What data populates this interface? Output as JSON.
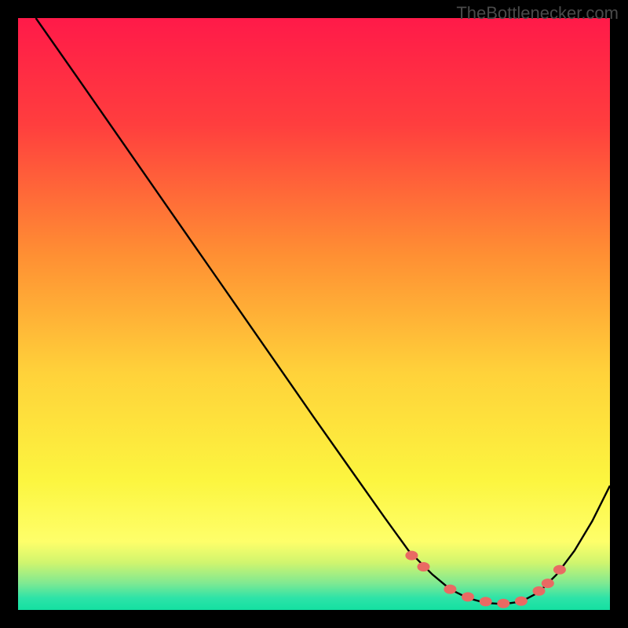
{
  "watermark": "TheBottlenecker.com",
  "chart_data": {
    "type": "line",
    "title": "",
    "xlabel": "",
    "ylabel": "",
    "xlim": [
      0,
      100
    ],
    "ylim": [
      0,
      100
    ],
    "background": "heat-gradient",
    "series": [
      {
        "name": "curve",
        "x": [
          3,
          10,
          18,
          26,
          34,
          42,
          50,
          56,
          62,
          66,
          70,
          73,
          76,
          79,
          82,
          85,
          88,
          91,
          94,
          97,
          100
        ],
        "y": [
          100,
          90,
          78.5,
          67,
          55.5,
          44,
          32.5,
          24,
          15.5,
          10,
          6,
          3.5,
          2,
          1.2,
          1,
          1.4,
          3,
          6,
          10,
          15,
          21
        ]
      }
    ],
    "markers": {
      "name": "dots",
      "color": "#e96a63",
      "x": [
        66.5,
        68.5,
        73,
        76,
        79,
        82,
        85,
        88,
        89.5,
        91.5
      ],
      "y": [
        9.2,
        7.3,
        3.5,
        2.2,
        1.4,
        1.1,
        1.5,
        3.2,
        4.5,
        6.8
      ]
    }
  },
  "gradient_stops": [
    {
      "offset": 0,
      "color": "#ff1a49"
    },
    {
      "offset": 0.18,
      "color": "#ff3e3e"
    },
    {
      "offset": 0.4,
      "color": "#ff8f33"
    },
    {
      "offset": 0.6,
      "color": "#ffd23a"
    },
    {
      "offset": 0.78,
      "color": "#fcf53f"
    },
    {
      "offset": 0.885,
      "color": "#feff6a"
    },
    {
      "offset": 0.92,
      "color": "#d0f56e"
    },
    {
      "offset": 0.955,
      "color": "#7fe992"
    },
    {
      "offset": 0.98,
      "color": "#2de3a8"
    },
    {
      "offset": 1.0,
      "color": "#14e0a1"
    }
  ]
}
